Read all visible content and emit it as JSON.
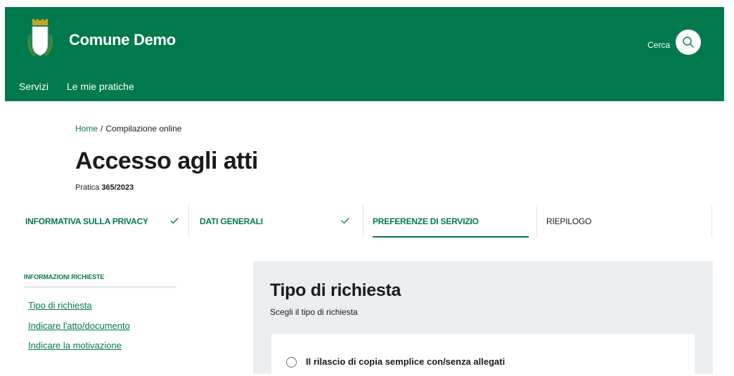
{
  "header": {
    "site_title": "Comune Demo",
    "search_label": "Cerca",
    "brand_color": "#00794d",
    "nav": [
      {
        "label": "Servizi"
      },
      {
        "label": "Le mie pratiche"
      }
    ]
  },
  "breadcrumb": {
    "home": "Home",
    "separator": "/",
    "current": "Compilazione online"
  },
  "page": {
    "title": "Accesso agli atti",
    "practice_prefix": "Pratica",
    "practice_number": "365/2023"
  },
  "steps": [
    {
      "label": "INFORMATIVA SULLA PRIVACY",
      "status": "completed"
    },
    {
      "label": "DATI GENERALI",
      "status": "completed"
    },
    {
      "label": "PREFERENZE DI SERVIZIO",
      "status": "active"
    },
    {
      "label": "RIEPILOGO",
      "status": "pending"
    }
  ],
  "sidebar": {
    "heading": "INFORMAZIONI RICHIESTE",
    "links": [
      {
        "label": "Tipo di richiesta"
      },
      {
        "label": "Indicare l'atto/documento"
      },
      {
        "label": "Indicare la motivazione"
      }
    ]
  },
  "section": {
    "title": "Tipo di richiesta",
    "subtitle": "Scegli il tipo di richiesta",
    "options": [
      {
        "label": "Il rilascio di copia semplice con/senza allegati",
        "selected": false
      }
    ]
  }
}
